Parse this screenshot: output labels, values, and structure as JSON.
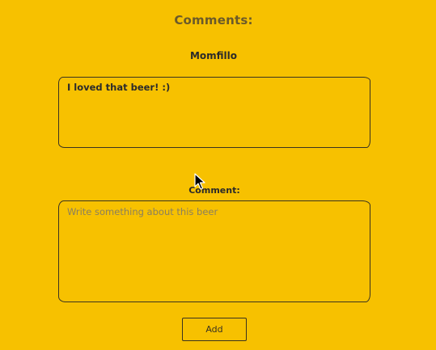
{
  "comments_section": {
    "title": "Comments:"
  },
  "comment": {
    "author": "Momfillo",
    "text": "I loved that beer! :)"
  },
  "form": {
    "label": "Comment:",
    "placeholder": "Write something about this beer",
    "value": "",
    "add_label": "Add"
  },
  "colors": {
    "background": "#f7c100",
    "border": "#3a3320"
  },
  "icons": {
    "pointer": "mouse-cursor-icon"
  }
}
